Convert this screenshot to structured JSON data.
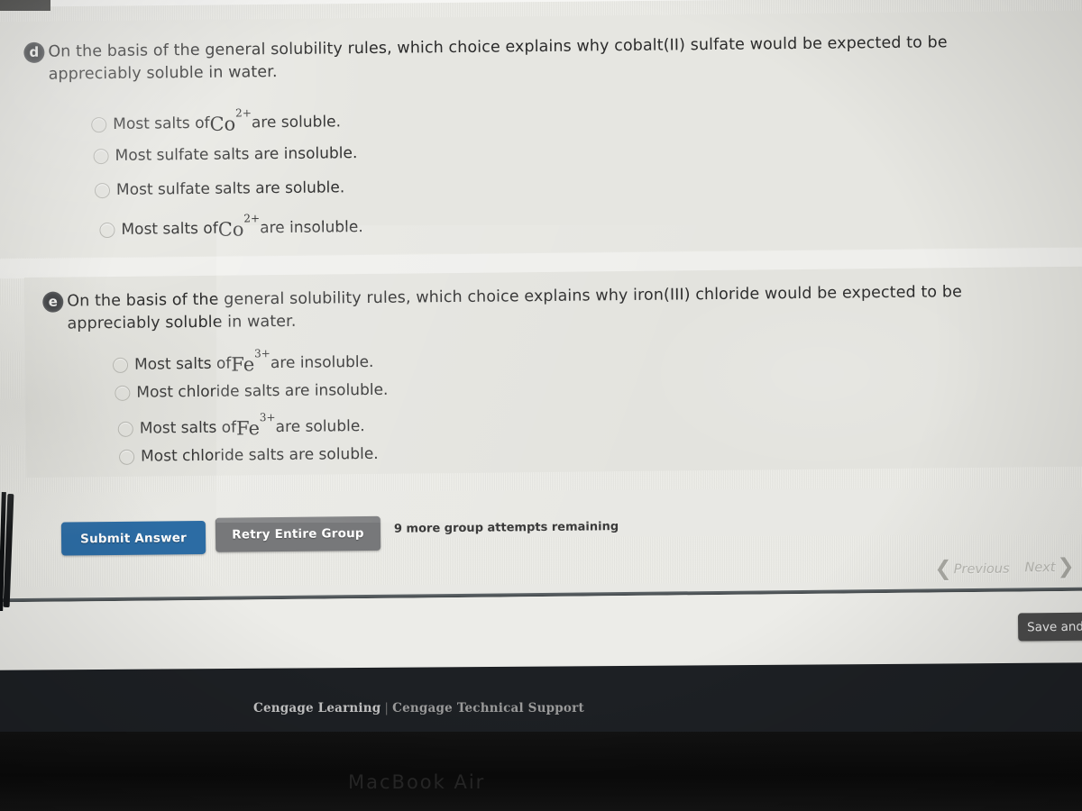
{
  "questions": [
    {
      "marker": "d",
      "prompt_line1": "On the basis of the general solubility rules, which choice explains why cobalt(II) sulfate would be expected to be",
      "prompt_line2": "appreciably soluble in water.",
      "options": [
        {
          "pre": "Most salts of ",
          "ion": "Co",
          "charge": "2+",
          "post": " are soluble."
        },
        {
          "pre": "Most sulfate salts are insoluble.",
          "ion": "",
          "charge": "",
          "post": ""
        },
        {
          "pre": "Most sulfate salts are soluble.",
          "ion": "",
          "charge": "",
          "post": ""
        },
        {
          "pre": "Most salts of ",
          "ion": "Co",
          "charge": "2+",
          "post": " are insoluble."
        }
      ]
    },
    {
      "marker": "e",
      "prompt_line1": "On the basis of the general solubility rules, which choice explains why iron(III) chloride would be expected to be",
      "prompt_line2": "appreciably soluble in water.",
      "options": [
        {
          "pre": "Most salts of ",
          "ion": "Fe",
          "charge": "3+",
          "post": " are insoluble."
        },
        {
          "pre": "Most chloride salts are insoluble.",
          "ion": "",
          "charge": "",
          "post": ""
        },
        {
          "pre": "Most salts of ",
          "ion": "Fe",
          "charge": "3+",
          "post": " are soluble."
        },
        {
          "pre": "Most chloride salts are soluble.",
          "ion": "",
          "charge": "",
          "post": ""
        }
      ]
    }
  ],
  "actions": {
    "submit_label": "Submit Answer",
    "retry_label": "Retry Entire Group",
    "attempts_text": "9 more group attempts remaining",
    "submit_color": "#2c6ca4",
    "retry_color": "#77787a"
  },
  "navigation": {
    "previous_label": "Previous",
    "next_label": "Next",
    "prev_chevron": "❮",
    "next_chevron": "❯"
  },
  "bottom_bar": {
    "save_label": "Save and E"
  },
  "footer": {
    "learning_label": "Cengage Learning",
    "separator": "|",
    "support_label": "Cengage Technical Support"
  },
  "device": {
    "model_label": "MacBook Air"
  }
}
